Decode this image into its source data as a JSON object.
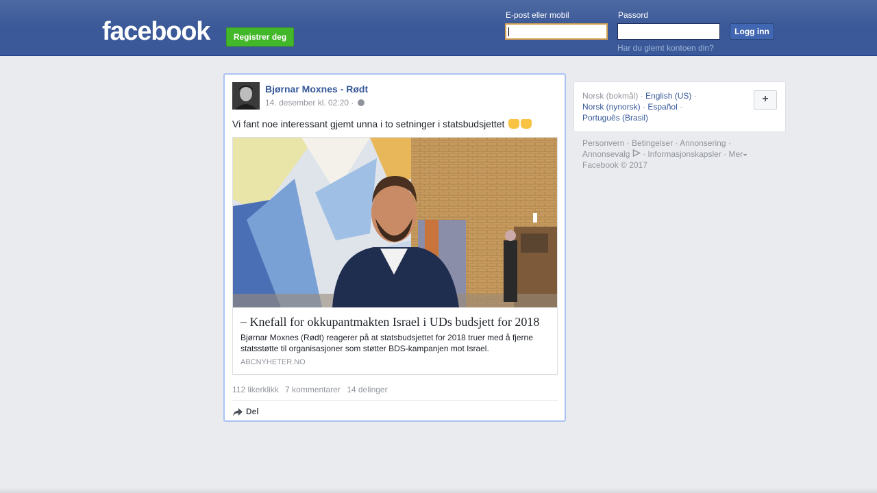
{
  "header": {
    "logo": "facebook",
    "signup_label": "Registrer deg",
    "email_label": "E-post eller mobil",
    "password_label": "Passord",
    "login_label": "Logg inn",
    "forgot_label": "Har du glemt kontoen din?"
  },
  "post": {
    "author": "Bjørnar Moxnes - Rødt",
    "timestamp": "14. desember kl. 02:20",
    "meta_sep": "·",
    "text": "Vi fant noe interessant gjemt unna i to setninger i statsbudsjettet",
    "link": {
      "title": "– Knefall for okkupantmakten Israel i UDs budsjett for 2018",
      "description": "Bjørnar Moxnes (Rødt) reagerer på at statsbudsjettet for 2018 truer med å fjerne statsstøtte til organisasjoner som støtter BDS-kampanjen mot Israel.",
      "domain": "ABCNYHETER.NO"
    },
    "stats": {
      "likes": "112 likerklikk",
      "comments": "7 kommentarer",
      "shares": "14 delinger"
    },
    "share_label": "Del"
  },
  "languages": {
    "current": "Norsk (bokmål)",
    "english": "English (US)",
    "nynorsk": "Norsk (nynorsk)",
    "espanol": "Español",
    "portugues": "Português (Brasil)",
    "sep": "·",
    "more_button": "+"
  },
  "footer": {
    "privacy": "Personvern",
    "terms": "Betingelser",
    "advertising": "Annonsering",
    "adchoices": "Annonsevalg",
    "cookies": "Informasjonskapsler",
    "more": "Mer",
    "copyright": "Facebook © 2017"
  },
  "colors": {
    "brand": "#3b5998",
    "signup": "#42b72a",
    "link": "#365899",
    "muted": "#90949c"
  }
}
